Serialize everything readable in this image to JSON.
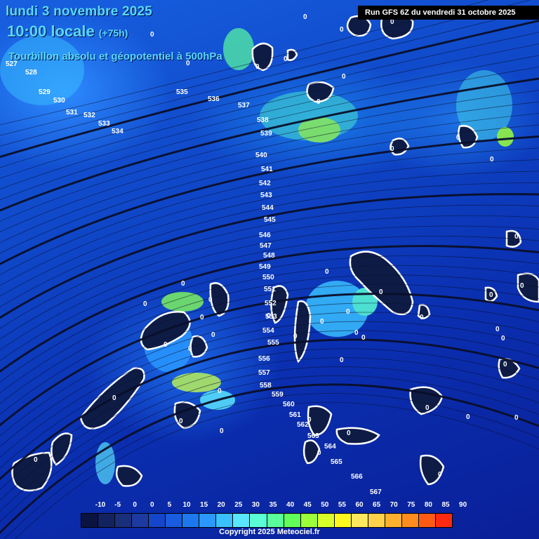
{
  "header": {
    "date_line": "lundi 3 novembre 2025",
    "time_line": "10:00 locale",
    "lead_time": "(+75h)",
    "field_title": "Tourbillon absolu et géopotentiel à 500hPa",
    "run_info": "Run GFS 6Z du vendredi 31 octobre 2025"
  },
  "footer": {
    "copyright": "Copyright 2025 Meteociel.fr"
  },
  "legend": {
    "labels": [
      "-10",
      "-5",
      "0",
      "0",
      "5",
      "10",
      "15",
      "20",
      "25",
      "30",
      "35",
      "40",
      "45",
      "50",
      "55",
      "60",
      "65",
      "70",
      "75",
      "80",
      "85",
      "90"
    ],
    "colors": [
      "#0b1440",
      "#12235f",
      "#1a2f7a",
      "#1d3aa0",
      "#1545c8",
      "#1a5ce0",
      "#1d78f0",
      "#2a98ff",
      "#3ac0ff",
      "#5ae6ff",
      "#5affd6",
      "#5aff9c",
      "#62ff5a",
      "#9cff3a",
      "#d8ff2a",
      "#fff71e",
      "#ffe860",
      "#ffd24a",
      "#ffb02e",
      "#ff8c1e",
      "#ff5a14",
      "#ff2a10"
    ]
  },
  "contour_labels": [
    "527",
    "528",
    "529",
    "530",
    "531",
    "532",
    "533",
    "534",
    "535",
    "536",
    "537",
    "538",
    "539",
    "540",
    "541",
    "542",
    "543",
    "544",
    "545",
    "546",
    "547",
    "548",
    "549",
    "550",
    "551",
    "552",
    "553",
    "554",
    "555",
    "556",
    "557",
    "558",
    "559",
    "560",
    "561",
    "562",
    "563",
    "564",
    "565",
    "566",
    "567"
  ],
  "zero_labels": [
    "0",
    "0",
    "0",
    "0",
    "0",
    "0",
    "0",
    "0",
    "0",
    "0",
    "0",
    "0",
    "0",
    "0",
    "0",
    "0",
    "0",
    "0",
    "0",
    "0",
    "0",
    "0",
    "0",
    "0",
    "0",
    "0",
    "0",
    "0",
    "0",
    "0",
    "0",
    "0",
    "0",
    "0",
    "0",
    "0",
    "0",
    "0",
    "0",
    "0",
    "0",
    "0",
    "0",
    "0",
    "0",
    "0",
    "0"
  ]
}
